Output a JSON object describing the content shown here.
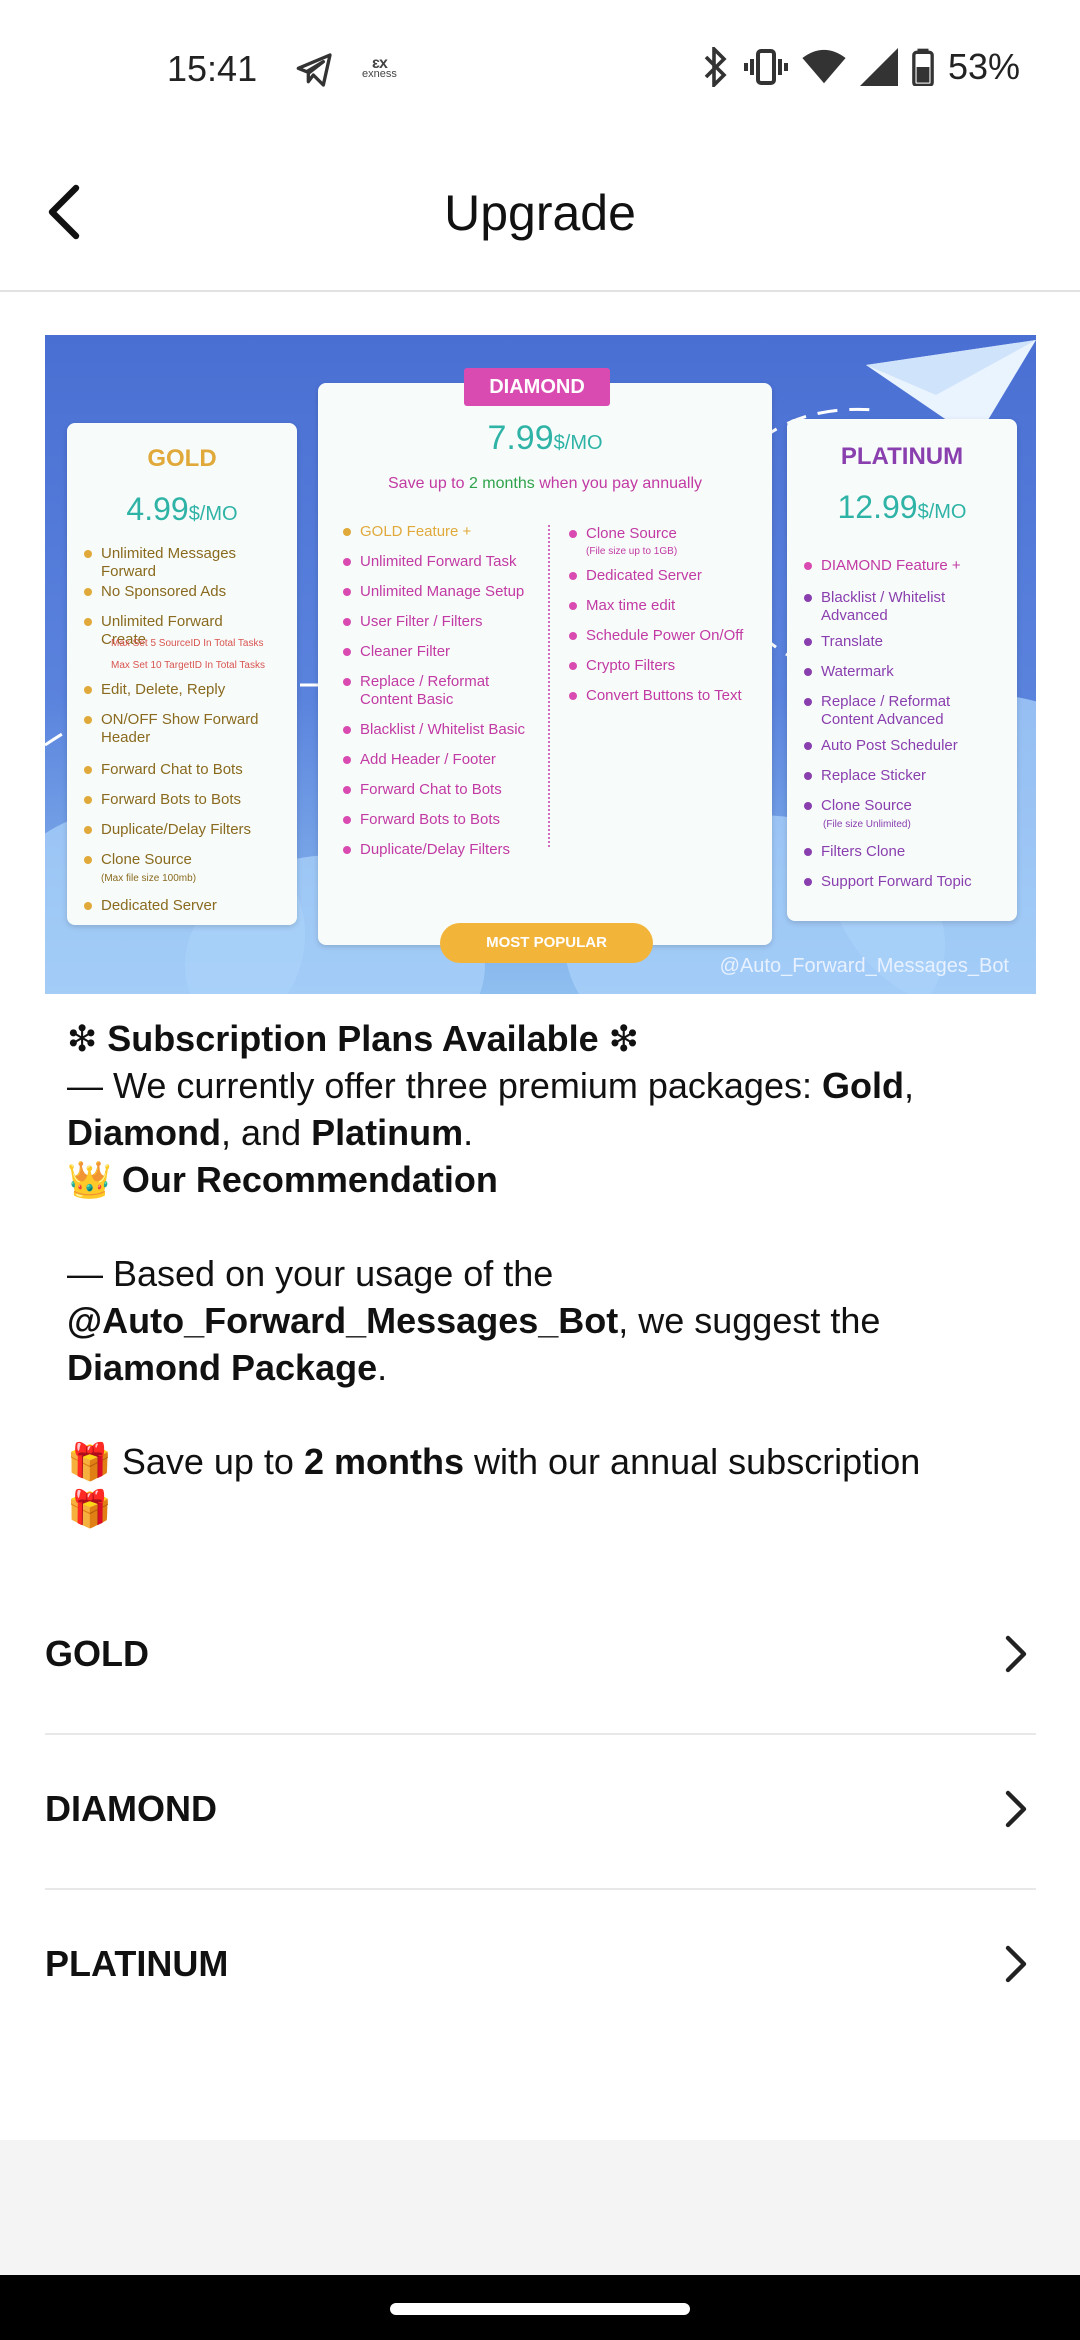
{
  "status_bar": {
    "time": "15:41",
    "exness_label": "exness",
    "battery": "53%"
  },
  "app_bar": {
    "title": "Upgrade",
    "back_icon": "arrow-left-icon"
  },
  "banner": {
    "gold": {
      "name": "GOLD",
      "price": "4.99",
      "unit": "$/MO",
      "features": [
        "Unlimited Messages Forward",
        "No Sponsored Ads",
        "Unlimited Forward Create",
        "Max Set 5 SourceID In Total Tasks",
        "Max Set 10 TargetID In Total Tasks",
        "Edit, Delete, Reply",
        "ON/OFF Show Forward Header",
        "Forward Chat to Bots",
        "Forward Bots to Bots",
        "Duplicate/Delay Filters",
        "Clone Source",
        "(Max file size 100mb)",
        "Dedicated Server"
      ]
    },
    "diamond": {
      "badge": "DIAMOND",
      "price": "7.99",
      "unit": "$/MO",
      "save_prefix": "Save up to ",
      "save_highlight": "2 months",
      "save_suffix": " when you pay annually",
      "features_left": [
        "GOLD Feature +",
        "Unlimited Forward Task",
        "Unlimited Manage Setup",
        "User Filter / Filters",
        "Cleaner Filter",
        "Replace / Reformat Content Basic",
        "Blacklist / Whitelist Basic",
        "Add Header / Footer",
        "Forward Chat to Bots",
        "Forward Bots to Bots",
        "Duplicate/Delay Filters"
      ],
      "features_right": [
        "Clone Source",
        "(File size up to 1GB)",
        "Dedicated Server",
        "Max time edit",
        "Schedule Power On/Off",
        "Crypto Filters",
        "Convert Buttons to Text"
      ],
      "most_popular": "MOST POPULAR"
    },
    "platinum": {
      "name": "PLATINUM",
      "price": "12.99",
      "unit": "$/MO",
      "features": [
        "DIAMOND Feature +",
        "Blacklist / Whitelist Advanced",
        "Translate",
        "Watermark",
        "Replace / Reformat Content Advanced",
        "Auto Post Scheduler",
        "Replace Sticker",
        "Clone Source",
        "(File size Unlimited)",
        "Filters Clone",
        "Support Forward Topic"
      ]
    },
    "watermark": "@Auto_Forward_Messages_Bot"
  },
  "message": {
    "heading": "Subscription Plans Available",
    "star": "❇",
    "offer_prefix": "— We currently offer three premium packages: ",
    "gold": "Gold",
    "comma": ",",
    "diamond": "Diamond",
    "and": ", and ",
    "platinum": "Platinum",
    "period": ".",
    "rec_emoji": "👑",
    "recommendation": "Our Recommendation",
    "based": "— Based on your usage of the",
    "bot": "@Auto_Forward_Messages_Bot",
    "suggest": ", we suggest the",
    "package": "Diamond Package",
    "gift": "🎁",
    "save_prefix": " Save up to ",
    "save_months": "2 months",
    "save_suffix": " with our annual subscription"
  },
  "plans": [
    {
      "label": "GOLD"
    },
    {
      "label": "DIAMOND"
    },
    {
      "label": "PLATINUM"
    }
  ],
  "colors": {
    "gold": "#e0a93a",
    "diamond": "#d94bb1",
    "platinum": "#8a3fae",
    "price_teal": "#2fb3a6"
  }
}
